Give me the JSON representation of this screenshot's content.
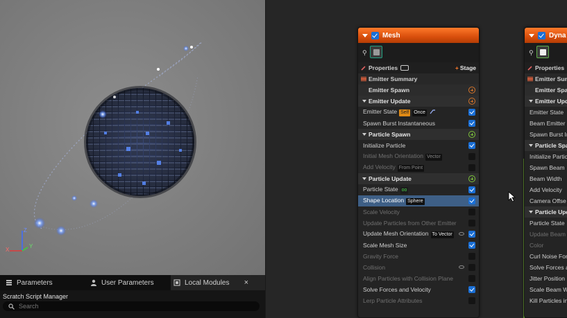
{
  "bottom_panel": {
    "tabs": [
      {
        "label": "Parameters",
        "icon": "parameters-icon",
        "active": false
      },
      {
        "label": "User Parameters",
        "icon": "user-icon",
        "active": false
      },
      {
        "label": "Local Modules",
        "icon": "module-icon",
        "active": true
      }
    ],
    "close_label": "×",
    "section_label": "Scratch Script Manager",
    "search_placeholder": "Search"
  },
  "viewport": {
    "axis_labels": [
      "Z",
      "X",
      "Y"
    ]
  },
  "nodes": [
    {
      "title": "Mesh",
      "properties_label": "Properties",
      "stage_label": "Stage",
      "rows": [
        {
          "kind": "summary",
          "label": "Emitter Summary"
        },
        {
          "kind": "subsection",
          "label": "Emitter Spawn",
          "add": "orange"
        },
        {
          "kind": "section",
          "label": "Emitter Update",
          "add": "orange"
        },
        {
          "kind": "item",
          "label": "Emitter State",
          "tags": [
            {
              "text": "Self",
              "style": "orange"
            },
            {
              "text": "Once",
              "style": "dark"
            }
          ],
          "extra_icon": true,
          "check": true
        },
        {
          "kind": "item",
          "label": "Spawn Burst Instantaneous",
          "check": true
        },
        {
          "kind": "section",
          "label": "Particle Spawn",
          "add": "green"
        },
        {
          "kind": "item",
          "label": "Initialize Particle",
          "check": true
        },
        {
          "kind": "item",
          "label": "Initial Mesh Orientation",
          "tags": [
            {
              "text": "Vector",
              "style": "dark"
            }
          ],
          "disabled": true,
          "check": false
        },
        {
          "kind": "item",
          "label": "Add Velocity",
          "tags": [
            {
              "text": "From Point",
              "style": "dark"
            }
          ],
          "disabled": true,
          "check": false
        },
        {
          "kind": "section",
          "label": "Particle Update",
          "add": "green"
        },
        {
          "kind": "item",
          "label": "Particle State",
          "tags": [
            {
              "text": "oo",
              "style": "green"
            }
          ],
          "check": true
        },
        {
          "kind": "item",
          "label": "Shape Location",
          "tags": [
            {
              "text": "Sphere",
              "style": "dark"
            }
          ],
          "selected": true,
          "check": true
        },
        {
          "kind": "item",
          "label": "Scale Velocity",
          "disabled": true,
          "check": false
        },
        {
          "kind": "item",
          "label": "Update Particles from Other Emitter",
          "disabled": true,
          "check": false
        },
        {
          "kind": "item",
          "label": "Update Mesh Orientation",
          "tags": [
            {
              "text": "To Vector",
              "style": "dark"
            }
          ],
          "eye": true,
          "check": true
        },
        {
          "kind": "item",
          "label": "Scale Mesh Size",
          "check": true
        },
        {
          "kind": "item",
          "label": "Gravity Force",
          "disabled": true,
          "check": false
        },
        {
          "kind": "item",
          "label": "Collision",
          "disabled": true,
          "eye": true,
          "check": false
        },
        {
          "kind": "item",
          "label": "Align Particles with Collision Plane",
          "disabled": true,
          "check": false
        },
        {
          "kind": "item",
          "label": "Solve Forces and Velocity",
          "check": true
        },
        {
          "kind": "item",
          "label": "Lerp Particle Attributes",
          "disabled": true,
          "check": false
        }
      ]
    },
    {
      "title": "Dyna",
      "properties_label": "Properties",
      "stage_label": "",
      "rows": [
        {
          "kind": "summary",
          "label": "Emitter Summary"
        },
        {
          "kind": "subsection",
          "label": "Emitter Spaw"
        },
        {
          "kind": "section",
          "label": "Emitter Upd"
        },
        {
          "kind": "item",
          "label": "Emitter State"
        },
        {
          "kind": "item",
          "label": "Beam Emitter S"
        },
        {
          "kind": "item",
          "label": "Spawn Burst In"
        },
        {
          "kind": "section",
          "label": "Particle Spa"
        },
        {
          "kind": "item",
          "label": "Initialize Partic"
        },
        {
          "kind": "item",
          "label": "Spawn Beam"
        },
        {
          "kind": "item",
          "label": "Beam Width"
        },
        {
          "kind": "item",
          "label": "Add Velocity"
        },
        {
          "kind": "item",
          "label": "Camera Offse"
        },
        {
          "kind": "section",
          "label": "Particle Upd"
        },
        {
          "kind": "item",
          "label": "Particle State"
        },
        {
          "kind": "item",
          "label": "Update Beam",
          "disabled": true
        },
        {
          "kind": "item",
          "label": "Color",
          "disabled": true
        },
        {
          "kind": "item",
          "label": "Curl Noise For"
        },
        {
          "kind": "item",
          "label": "Solve Forces a"
        },
        {
          "kind": "item",
          "label": "Jitter Position"
        },
        {
          "kind": "item",
          "label": "Scale Beam W"
        },
        {
          "kind": "item",
          "label": "Kill Particles in"
        }
      ]
    }
  ],
  "colors": {
    "header_orange": "#e0540f",
    "checkbox_blue": "#1a6fd6",
    "selected_row": "#3e5f86",
    "add_green": "#7cc23a"
  }
}
